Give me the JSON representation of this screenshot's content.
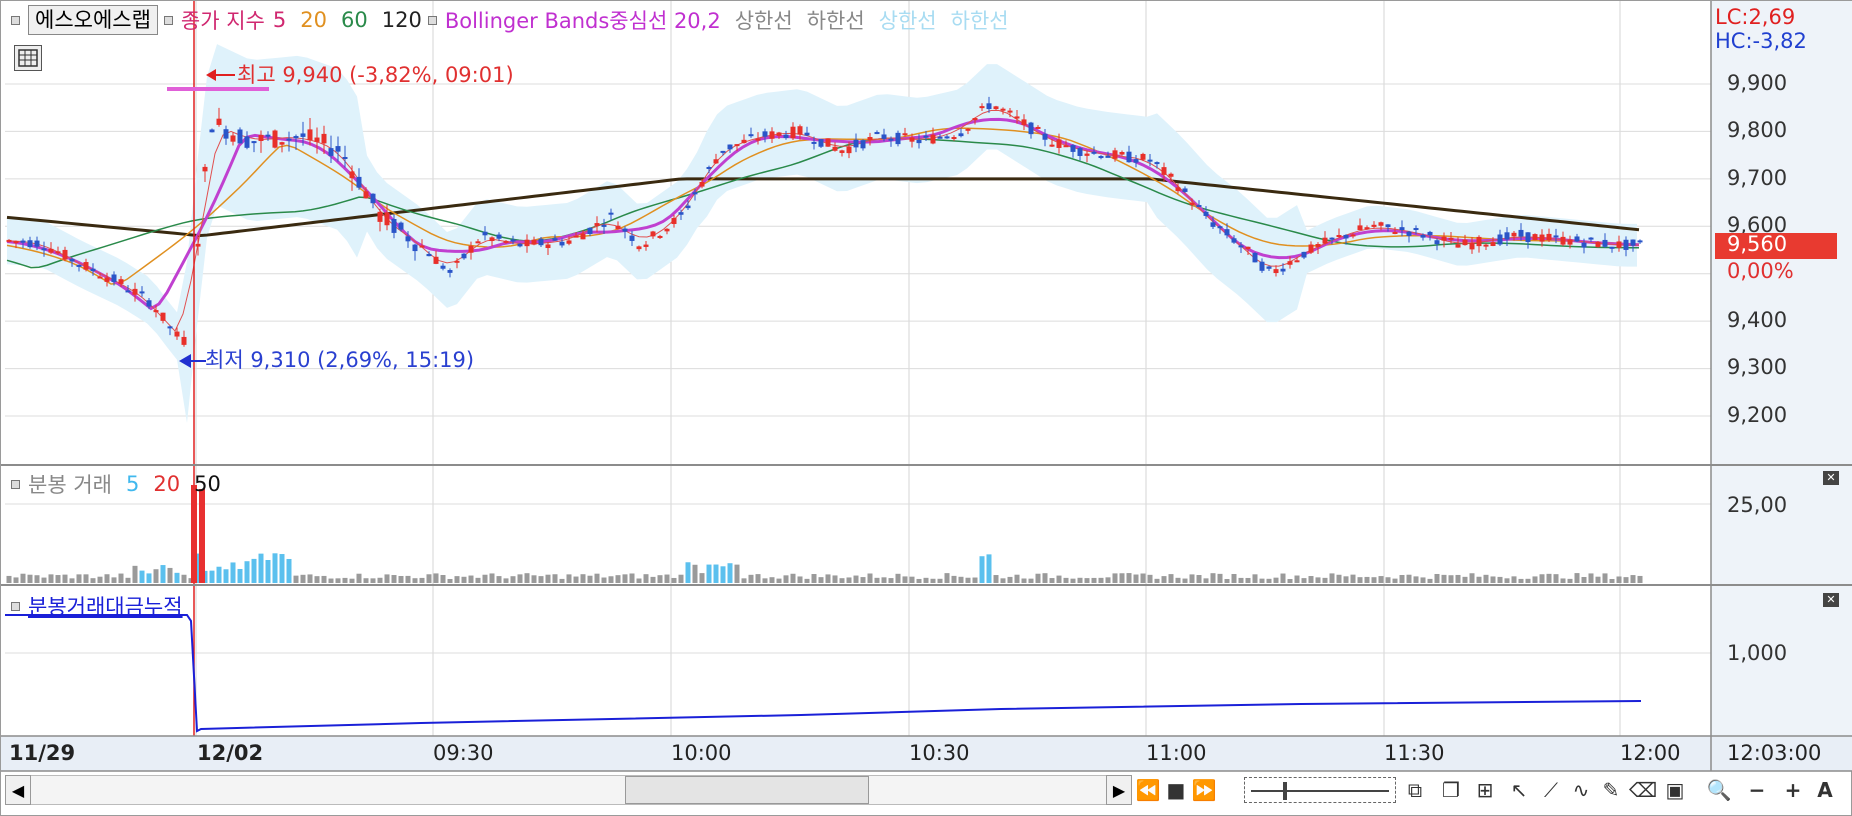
{
  "price_panel": {
    "stock_name": "에스오에스랩",
    "ma_legend": {
      "label": "종가 지수",
      "p5": "5",
      "p20": "20",
      "p60": "60",
      "p120": "120"
    },
    "bb_legend": {
      "label": "Bollinger Bands중심선 20,2",
      "upper": "상한선",
      "lower": "하한선",
      "upper2": "상한선",
      "lower2": "하한선"
    },
    "lc": "LC:2,69",
    "hc": "HC:-3,82",
    "high_annotation": "최고 9,940 (-3,82%, 09:01)",
    "low_annotation": "최저 9,310 (2,69%, 15:19)",
    "current_price": "9,560",
    "change_pct": "0,00%",
    "y_ticks": [
      "9,900",
      "9,800",
      "9,700",
      "9,600",
      "9,400",
      "9,300",
      "9,200"
    ]
  },
  "volume_panel": {
    "legend_label": "분봉 거래",
    "p5": "5",
    "p20": "20",
    "p50": "50",
    "y_tick": "25,00"
  },
  "amount_panel": {
    "legend_label": "분봉거래대금누적",
    "y_tick": "1,000"
  },
  "time_axis": {
    "labels": [
      "11/29",
      "12/02",
      "09:30",
      "10:00",
      "10:30",
      "11:00",
      "11:30",
      "12:00"
    ],
    "current_time": "12:03:00"
  },
  "colors": {
    "up": "#e8302a",
    "down": "#2a55c8",
    "ma5": "#e05050",
    "ma20": "#e09020",
    "ma60": "#2a8a4a",
    "ma120": "#3a2a10",
    "bb_mid": "#c040d0",
    "bb_band": "#dff2fb",
    "vol_hl": "#5bc0ee",
    "amount_line": "#1a20d8"
  },
  "toolbar_icons": [
    "play-icon",
    "rewind-icon",
    "stop-icon",
    "fast-forward-icon",
    "zoom-slider-icon",
    "window-icon",
    "window-cascade-icon",
    "crosshair-icon",
    "cursor-icon",
    "trend-icon",
    "line-icon",
    "draw-icon",
    "eraser-icon",
    "save-icon",
    "search-icon",
    "zoom-out-icon",
    "zoom-in-icon",
    "text-icon"
  ]
}
